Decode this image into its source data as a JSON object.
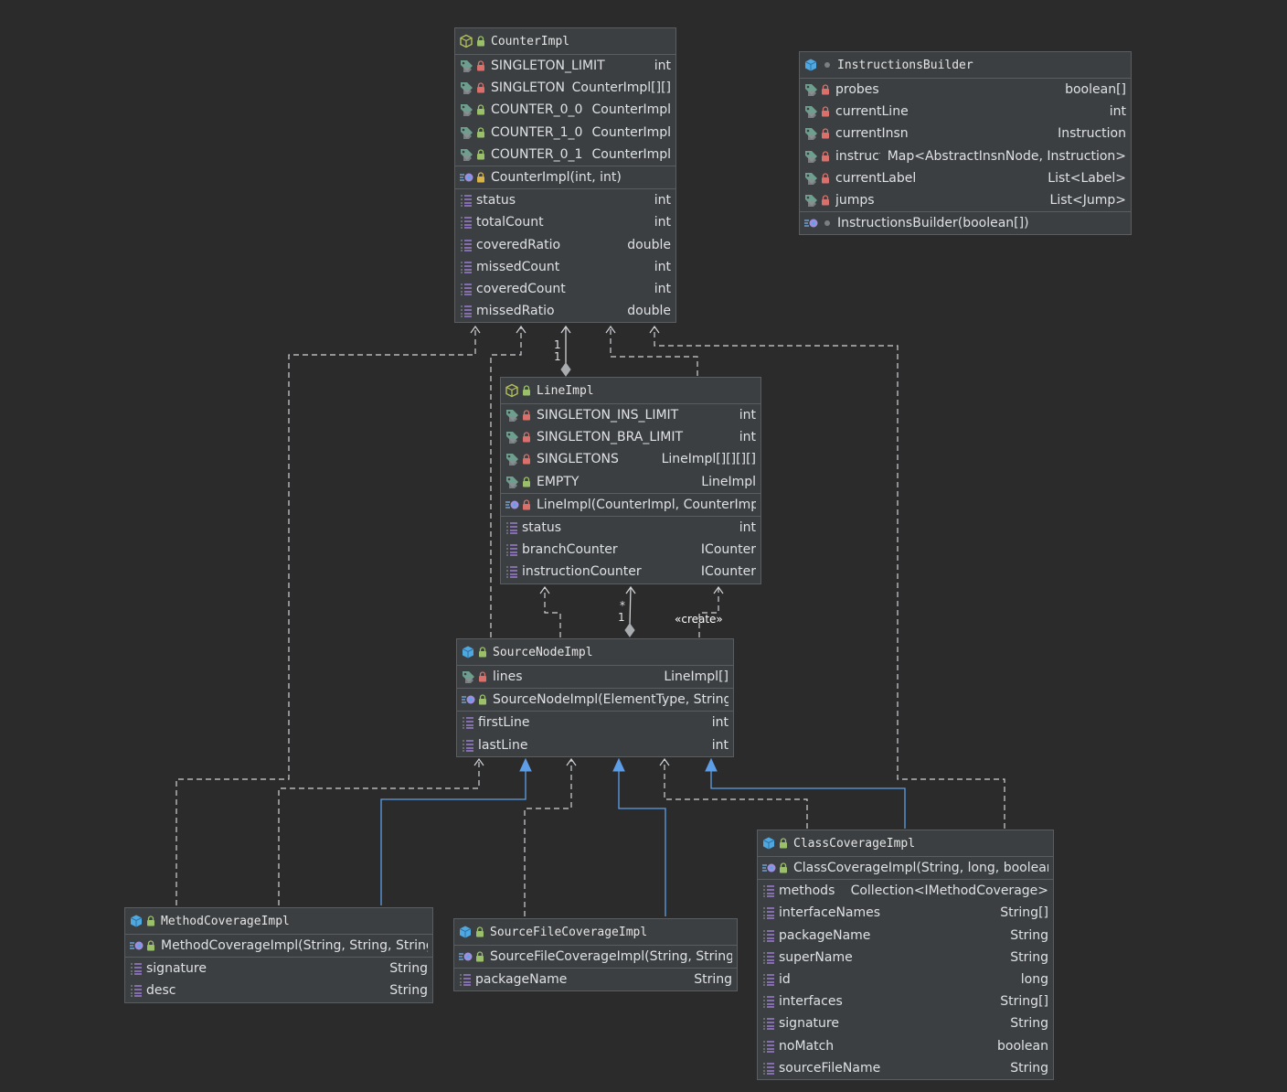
{
  "classes": {
    "counter_impl": {
      "name": "CounterImpl",
      "fields": [
        {
          "name": "SINGLETON_LIMIT",
          "type": "int",
          "lock": "red"
        },
        {
          "name": "SINGLETONS",
          "type": "CounterImpl[][]",
          "lock": "red"
        },
        {
          "name": "COUNTER_0_0",
          "type": "CounterImpl",
          "lock": "green"
        },
        {
          "name": "COUNTER_1_0",
          "type": "CounterImpl",
          "lock": "green"
        },
        {
          "name": "COUNTER_0_1",
          "type": "CounterImpl",
          "lock": "green"
        }
      ],
      "constructors": [
        {
          "name": "CounterImpl(int, int)",
          "lock": "yellow"
        }
      ],
      "properties": [
        {
          "name": "status",
          "type": "int"
        },
        {
          "name": "totalCount",
          "type": "int"
        },
        {
          "name": "coveredRatio",
          "type": "double"
        },
        {
          "name": "missedCount",
          "type": "int"
        },
        {
          "name": "coveredCount",
          "type": "int"
        },
        {
          "name": "missedRatio",
          "type": "double"
        }
      ]
    },
    "instructions_builder": {
      "name": "InstructionsBuilder",
      "fields": [
        {
          "name": "probes",
          "type": "boolean[]",
          "lock": "red"
        },
        {
          "name": "currentLine",
          "type": "int",
          "lock": "red"
        },
        {
          "name": "currentInsn",
          "type": "Instruction",
          "lock": "red"
        },
        {
          "name": "instructions",
          "type": "Map<AbstractInsnNode, Instruction>",
          "lock": "red"
        },
        {
          "name": "currentLabel",
          "type": "List<Label>",
          "lock": "red"
        },
        {
          "name": "jumps",
          "type": "List<Jump>",
          "lock": "red"
        }
      ],
      "constructors": [
        {
          "name": "InstructionsBuilder(boolean[])",
          "lock": "dot"
        }
      ]
    },
    "line_impl": {
      "name": "LineImpl",
      "fields": [
        {
          "name": "SINGLETON_INS_LIMIT",
          "type": "int",
          "lock": "red"
        },
        {
          "name": "SINGLETON_BRA_LIMIT",
          "type": "int",
          "lock": "red"
        },
        {
          "name": "SINGLETONS",
          "type": "LineImpl[][][][]",
          "lock": "red"
        },
        {
          "name": "EMPTY",
          "type": "LineImpl",
          "lock": "green"
        }
      ],
      "constructors": [
        {
          "name": "LineImpl(CounterImpl, CounterImpl)",
          "lock": "red"
        }
      ],
      "properties": [
        {
          "name": "status",
          "type": "int"
        },
        {
          "name": "branchCounter",
          "type": "ICounter"
        },
        {
          "name": "instructionCounter",
          "type": "ICounter"
        }
      ]
    },
    "source_node_impl": {
      "name": "SourceNodeImpl",
      "fields": [
        {
          "name": "lines",
          "type": "LineImpl[]",
          "lock": "red"
        }
      ],
      "constructors": [
        {
          "name": "SourceNodeImpl(ElementType, String)",
          "lock": "green"
        }
      ],
      "properties": [
        {
          "name": "firstLine",
          "type": "int"
        },
        {
          "name": "lastLine",
          "type": "int"
        }
      ]
    },
    "method_coverage_impl": {
      "name": "MethodCoverageImpl",
      "constructors": [
        {
          "name": "MethodCoverageImpl(String, String, String)",
          "lock": "green"
        }
      ],
      "properties": [
        {
          "name": "signature",
          "type": "String"
        },
        {
          "name": "desc",
          "type": "String"
        }
      ]
    },
    "source_file_coverage_impl": {
      "name": "SourceFileCoverageImpl",
      "constructors": [
        {
          "name": "SourceFileCoverageImpl(String, String)",
          "lock": "green"
        }
      ],
      "properties": [
        {
          "name": "packageName",
          "type": "String"
        }
      ]
    },
    "class_coverage_impl": {
      "name": "ClassCoverageImpl",
      "constructors": [
        {
          "name": "ClassCoverageImpl(String, long, boolean)",
          "lock": "green"
        }
      ],
      "properties": [
        {
          "name": "methods",
          "type": "Collection<IMethodCoverage>"
        },
        {
          "name": "interfaceNames",
          "type": "String[]"
        },
        {
          "name": "packageName",
          "type": "String"
        },
        {
          "name": "superName",
          "type": "String"
        },
        {
          "name": "id",
          "type": "long"
        },
        {
          "name": "interfaces",
          "type": "String[]"
        },
        {
          "name": "signature",
          "type": "String"
        },
        {
          "name": "noMatch",
          "type": "boolean"
        },
        {
          "name": "sourceFileName",
          "type": "String"
        }
      ]
    }
  },
  "relations": {
    "counter_line_mult_a": "1",
    "counter_line_mult_b": "1",
    "line_source_mult_a": "*",
    "line_source_mult_b": "1",
    "create_label": "«create»"
  },
  "colors": {
    "background": "#2b2b2b",
    "box": "#3c3f41",
    "border": "#5b5e61",
    "dashed_line": "#cfd2d6",
    "inheritance_line": "#5d9ee6"
  }
}
